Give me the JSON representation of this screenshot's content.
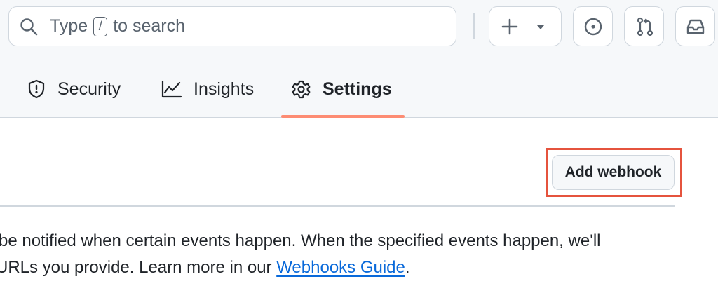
{
  "header": {
    "search": {
      "text_before": "Type",
      "shortcut_key": "/",
      "text_after": "to search",
      "icon": "search-icon"
    },
    "buttons": [
      {
        "icon": "plus-icon",
        "dropdown_icon": "triangle-down-icon"
      },
      {
        "icon": "issue-opened-icon"
      },
      {
        "icon": "git-pull-request-icon"
      },
      {
        "icon": "inbox-icon"
      }
    ]
  },
  "tabs": [
    {
      "label": "Security",
      "icon": "shield-icon"
    },
    {
      "label": "Insights",
      "icon": "graph-icon"
    },
    {
      "label": "Settings",
      "icon": "gear-icon",
      "active": true
    }
  ],
  "webhooks": {
    "add_button_label": "Add webhook",
    "description_line1": "be notified when certain events happen. When the specified events happen, we'll",
    "description_line2_prefix": "URLs you provide. Learn more in our ",
    "guide_link": "Webhooks Guide",
    "description_line2_suffix": "."
  },
  "colors": {
    "tab_underline": "#fd8c73",
    "highlight_box": "#e5533d",
    "link": "#0969da",
    "header_bg": "#f6f8fa"
  }
}
